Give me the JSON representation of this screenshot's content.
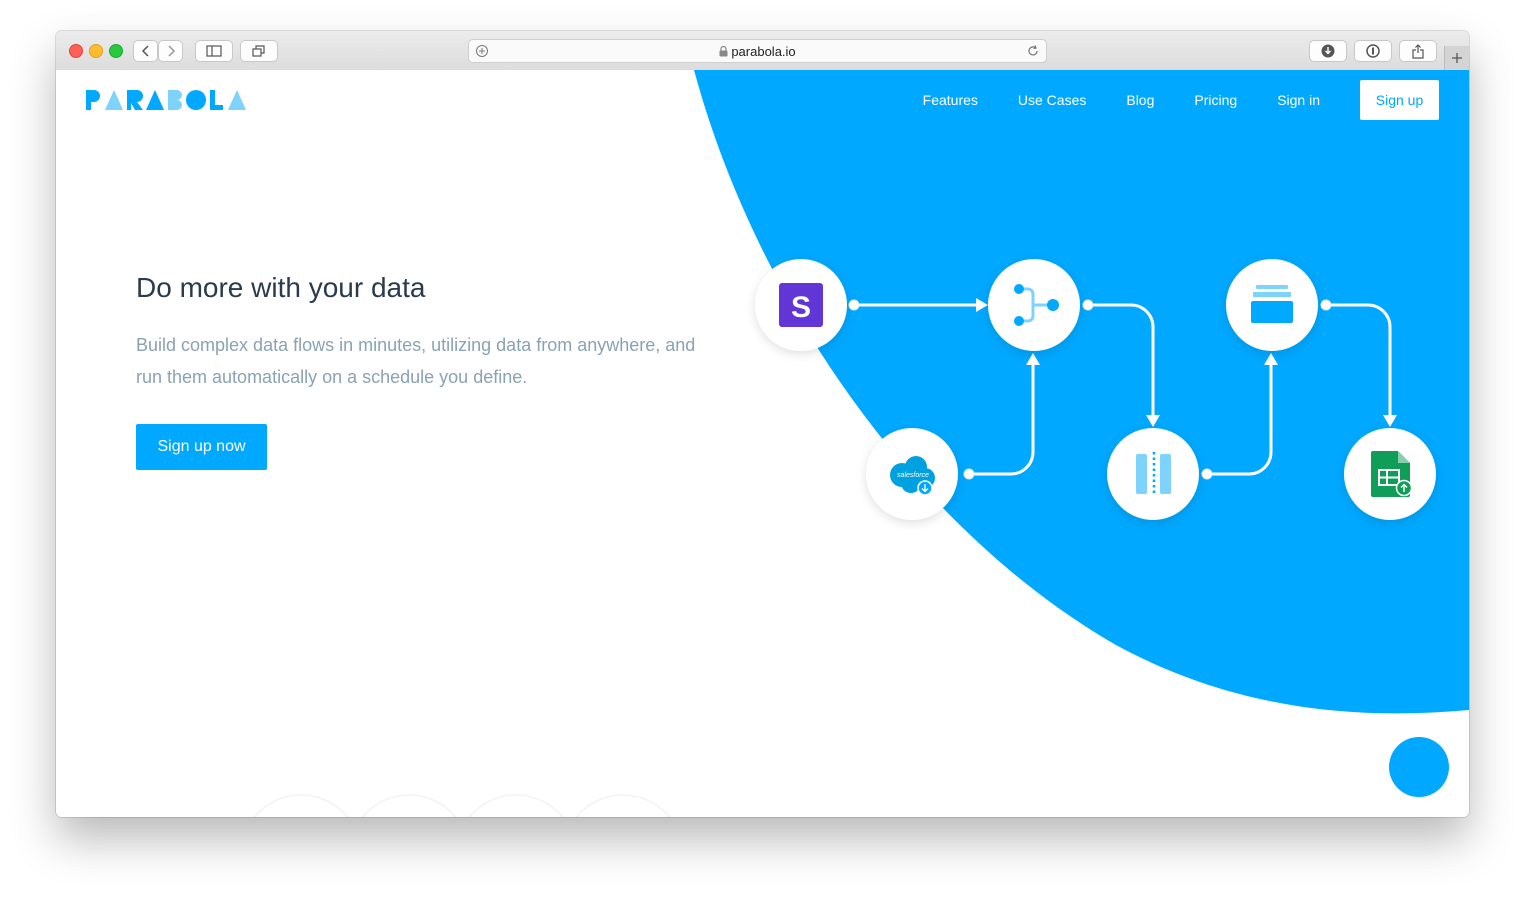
{
  "browser": {
    "url": "parabola.io"
  },
  "brand": {
    "logo_text": "PARABOLA",
    "accent": "#00a8ff"
  },
  "nav": {
    "items": [
      {
        "label": "Features"
      },
      {
        "label": "Use Cases"
      },
      {
        "label": "Blog"
      },
      {
        "label": "Pricing"
      },
      {
        "label": "Sign in"
      }
    ],
    "signup_label": "Sign up"
  },
  "hero": {
    "title": "Do more with your data",
    "subtitle": "Build complex data flows in minutes, utilizing data from anywhere, and run them automatically on a schedule you define.",
    "cta_label": "Sign up now"
  },
  "flow_diagram": {
    "nodes": [
      {
        "name": "stripe-source",
        "icon": "stripe-icon",
        "label": "S"
      },
      {
        "name": "merge-step",
        "icon": "merge-icon"
      },
      {
        "name": "stack-step",
        "icon": "stack-icon"
      },
      {
        "name": "salesforce-source",
        "icon": "salesforce-icon",
        "label": "salesforce"
      },
      {
        "name": "columns-step",
        "icon": "columns-icon"
      },
      {
        "name": "sheets-export",
        "icon": "google-sheets-icon"
      }
    ]
  },
  "chat": {
    "icon": "chat-icon"
  }
}
